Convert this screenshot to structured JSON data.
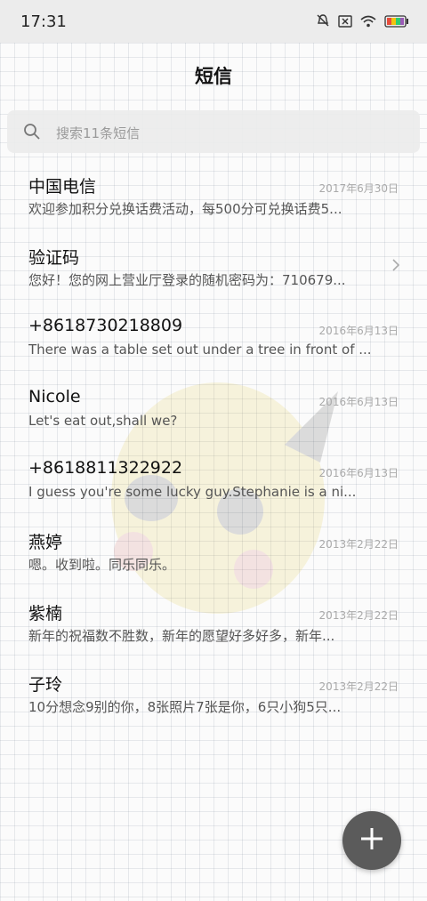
{
  "status_bar": {
    "time": "17:31",
    "icons": [
      "mute-bell-icon",
      "no-sim-icon",
      "wifi-icon",
      "battery-icon"
    ]
  },
  "header": {
    "title": "短信"
  },
  "search": {
    "placeholder": "搜索11条短信",
    "icon": "search-icon"
  },
  "messages": [
    {
      "name": "中国电信",
      "date": "2017年6月30日",
      "preview": "欢迎参加积分兑换话费活动，每500分可兑换话费5..."
    },
    {
      "name": "验证码",
      "date": "",
      "preview": "您好！您的网上营业厅登录的随机密码为：710679...",
      "icon": "chevron-right-icon"
    },
    {
      "name": "+8618730218809",
      "date": "2016年6月13日",
      "preview": "There was a table set out under a tree in front of ..."
    },
    {
      "name": "Nicole",
      "date": "2016年6月13日",
      "preview": "Let's eat out,shall we?"
    },
    {
      "name": "+8618811322922",
      "date": "2016年6月13日",
      "preview": "I guess you're some lucky guy.Stephanie is a ni..."
    },
    {
      "name": "燕婷",
      "date": "2013年2月22日",
      "preview": "嗯。收到啦。同乐同乐。"
    },
    {
      "name": "紫楠",
      "date": "2013年2月22日",
      "preview": "新年的祝福数不胜数，新年的愿望好多好多，新年..."
    },
    {
      "name": "子玲",
      "date": "2013年2月22日",
      "preview": "10分想念9别的你，8张照片7张是你，6只小狗5只..."
    }
  ],
  "fab": {
    "icon": "plus-icon"
  },
  "colors": {
    "fab": "#5b5b5b",
    "date": "#aaaaaa",
    "preview": "#555555"
  }
}
